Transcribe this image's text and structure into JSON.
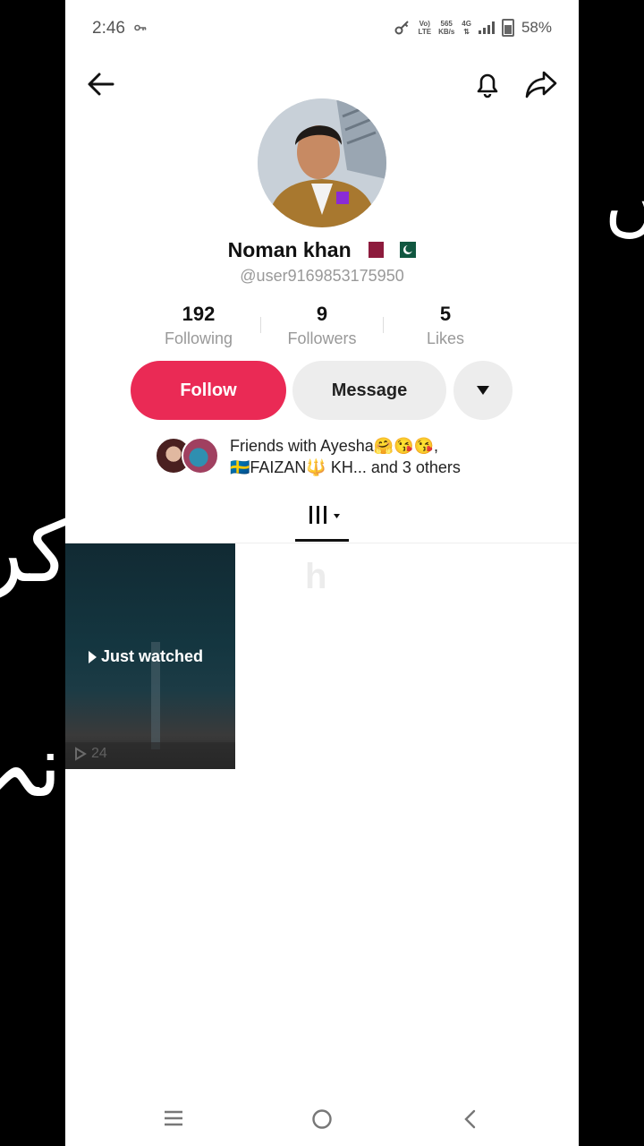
{
  "status_bar": {
    "time": "2:46",
    "network_top": "Vo)",
    "network_bottom": "LTE",
    "speed_top": "565",
    "speed_bottom": "KB/s",
    "gen": "4G",
    "battery": "58%"
  },
  "profile": {
    "name": "Noman khan",
    "username": "@user9169853175950",
    "stats": [
      {
        "value": "192",
        "label": "Following"
      },
      {
        "value": "9",
        "label": "Followers"
      },
      {
        "value": "5",
        "label": "Likes"
      }
    ]
  },
  "actions": {
    "follow": "Follow",
    "message": "Message"
  },
  "friends": {
    "line1": "Friends with Ayesha🤗😘😘,",
    "line2": "🇸🇪FAIZAN🔱 KH... and 3 others"
  },
  "grid": {
    "video_label": "Just watched",
    "video_views": "24"
  },
  "overlay_text": {
    "right": "ں",
    "left_middle": "کر",
    "left_bottom": "نہ"
  },
  "colors": {
    "accent": "#ea2a55",
    "button_gray": "#ededed",
    "muted_text": "#999999"
  },
  "icons": [
    "back-arrow-icon",
    "bell-icon",
    "share-icon",
    "dropdown-icon",
    "grid-icon",
    "play-icon",
    "menu-icon",
    "home-icon",
    "nav-back-icon"
  ]
}
